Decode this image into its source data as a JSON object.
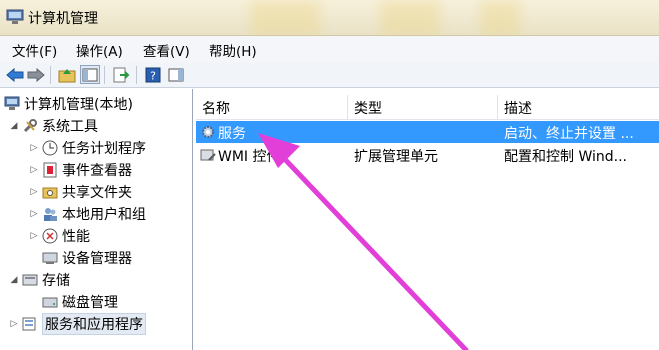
{
  "window": {
    "title": "计算机管理"
  },
  "menu": {
    "file": "文件(F)",
    "action": "操作(A)",
    "view": "查看(V)",
    "help": "帮助(H)"
  },
  "tree": {
    "root": "计算机管理(本地)",
    "system_tools": "系统工具",
    "task_scheduler": "任务计划程序",
    "event_viewer": "事件查看器",
    "shared_folders": "共享文件夹",
    "local_users": "本地用户和组",
    "performance": "性能",
    "device_manager": "设备管理器",
    "storage": "存储",
    "disk_management": "磁盘管理",
    "services_apps": "服务和应用程序"
  },
  "list": {
    "columns": {
      "name": "名称",
      "type": "类型",
      "description": "描述"
    },
    "rows": [
      {
        "name": "服务",
        "type": "",
        "description": "启动、终止并设置 ..."
      },
      {
        "name": "WMI 控件",
        "type": "扩展管理单元",
        "description": "配置和控制 Wind..."
      }
    ]
  },
  "colors": {
    "selection": "#3399ff",
    "arrow": "#e23fd8"
  }
}
